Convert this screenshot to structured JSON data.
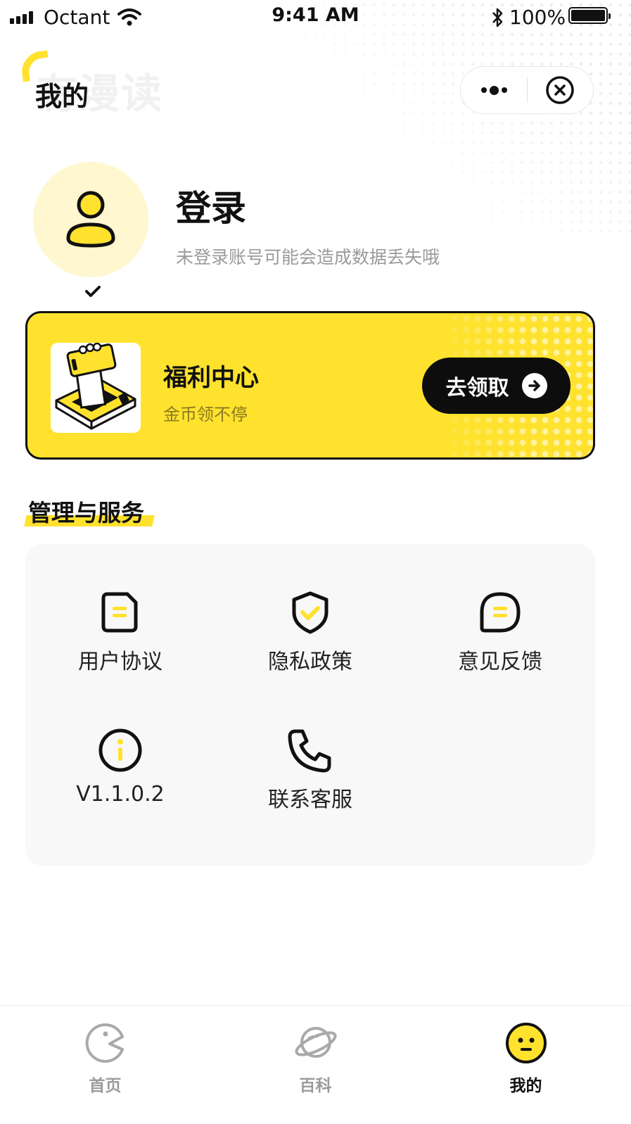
{
  "status_bar": {
    "carrier": "Octant",
    "time": "9:41 AM",
    "battery": "100%"
  },
  "nav": {
    "watermark": "有漫读",
    "title": "我的"
  },
  "profile": {
    "login_title": "登录",
    "login_subtitle": "未登录账号可能会造成数据丢失哦"
  },
  "welfare": {
    "title": "福利中心",
    "subtitle": "金币领不停",
    "button_label": "去领取"
  },
  "services": {
    "section_title": "管理与服务",
    "items": [
      {
        "label": "用户协议",
        "icon": "document-icon"
      },
      {
        "label": "隐私政策",
        "icon": "shield-check-icon"
      },
      {
        "label": "意见反馈",
        "icon": "chat-bubble-icon"
      },
      {
        "label": "V1.1.0.2",
        "icon": "info-icon"
      },
      {
        "label": "联系客服",
        "icon": "phone-icon"
      }
    ]
  },
  "tabbar": {
    "tabs": [
      {
        "label": "首页",
        "icon": "pacman-icon",
        "active": false
      },
      {
        "label": "百科",
        "icon": "planet-icon",
        "active": false
      },
      {
        "label": "我的",
        "icon": "smiley-icon",
        "active": true
      }
    ]
  },
  "colors": {
    "accent_yellow": "#ffe22e",
    "avatar_bg": "#fff7d0",
    "text_primary": "#111111",
    "text_muted": "#9a9a9a"
  }
}
